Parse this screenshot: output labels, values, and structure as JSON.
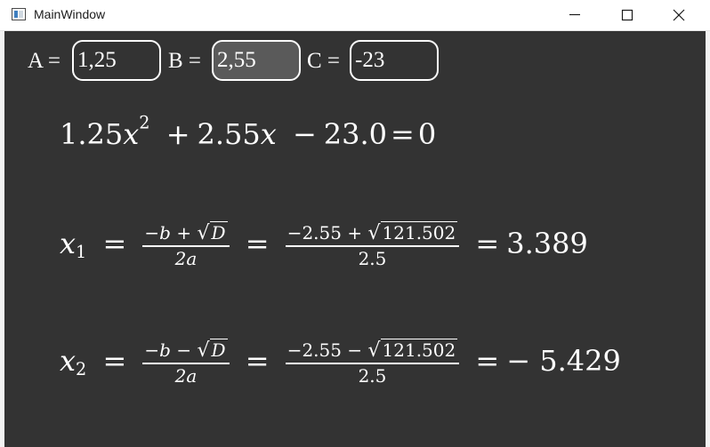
{
  "window": {
    "title": "MainWindow",
    "controls": {
      "minimize": "minimize-icon",
      "maximize": "maximize-icon",
      "close": "close-icon"
    }
  },
  "inputs": {
    "a_label": "A =",
    "a_value": "1,25",
    "b_label": "B =",
    "b_value": "2,55",
    "c_label": "C =",
    "c_value": "-23"
  },
  "equation": {
    "a": "1.25",
    "var": "x",
    "power": "2",
    "plus1": "+",
    "b": "2.55",
    "minus": "−",
    "c": "23.0",
    "equals": "=",
    "rhs": "0"
  },
  "root1": {
    "var": "x",
    "index": "1",
    "formula_num_neg_b": "−b",
    "formula_op": "+",
    "formula_sqrt": "D",
    "formula_den": "2a",
    "num_b": "−2.55",
    "num_op": "+",
    "num_sqrt": "121.502",
    "num_den": "2.5",
    "result": "3.389"
  },
  "root2": {
    "var": "x",
    "index": "2",
    "formula_num_neg_b": "−b",
    "formula_op": "−",
    "formula_sqrt": "D",
    "formula_den": "2a",
    "num_b": "−2.55",
    "num_op": "−",
    "num_sqrt": "121.502",
    "num_den": "2.5",
    "result": "− 5.429"
  },
  "colors": {
    "client_bg": "#333333",
    "text": "#ffffff",
    "focused_input_bg": "#5a5a5a"
  }
}
